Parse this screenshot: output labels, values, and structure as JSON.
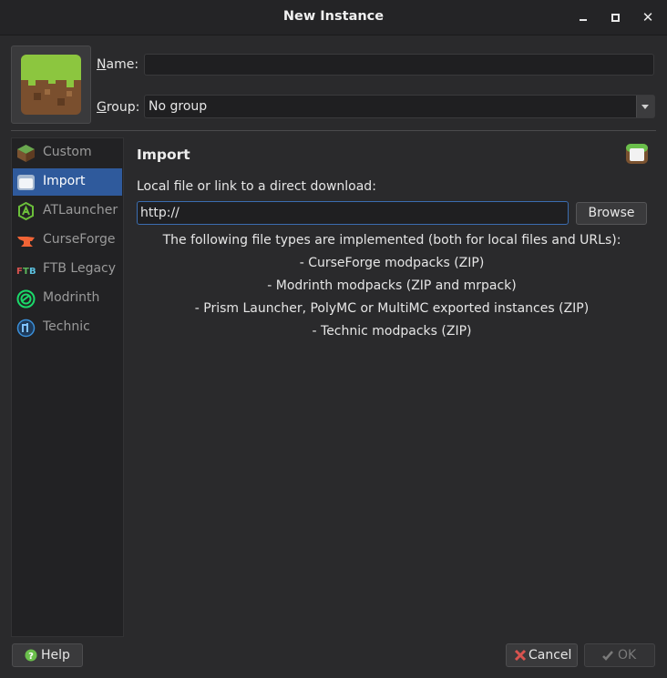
{
  "window": {
    "title": "New Instance"
  },
  "form": {
    "name_label": "Name:",
    "name_label_rest": "ame:",
    "name_mnemonic": "N",
    "name_value": "",
    "group_label_rest": "roup:",
    "group_mnemonic": "G",
    "group_value": "No group"
  },
  "sidebar": {
    "items": [
      {
        "label": "Custom",
        "icon": "grass-block-icon"
      },
      {
        "label": "Import",
        "icon": "folder-icon",
        "active": true
      },
      {
        "label": "ATLauncher",
        "icon": "atlauncher-icon"
      },
      {
        "label": "CurseForge",
        "icon": "curseforge-icon"
      },
      {
        "label": "FTB Legacy",
        "icon": "ftb-icon"
      },
      {
        "label": "Modrinth",
        "icon": "modrinth-icon"
      },
      {
        "label": "Technic",
        "icon": "technic-icon"
      }
    ]
  },
  "import": {
    "title": "Import",
    "prompt": "Local file or link to a direct download:",
    "url_value": "http://",
    "browse_label": "Browse",
    "info_lines": [
      "The following file types are implemented (both for local files and URLs):",
      "- CurseForge modpacks (ZIP)",
      "- Modrinth modpacks (ZIP and mrpack)",
      "- Prism Launcher, PolyMC or MultiMC exported instances (ZIP)",
      "- Technic modpacks (ZIP)"
    ]
  },
  "footer": {
    "help_label": "Help",
    "cancel_label": "Cancel",
    "ok_label": "OK"
  },
  "colors": {
    "accent": "#2f5a9c",
    "background": "#2a2a2c",
    "sidebar": "#222224"
  }
}
